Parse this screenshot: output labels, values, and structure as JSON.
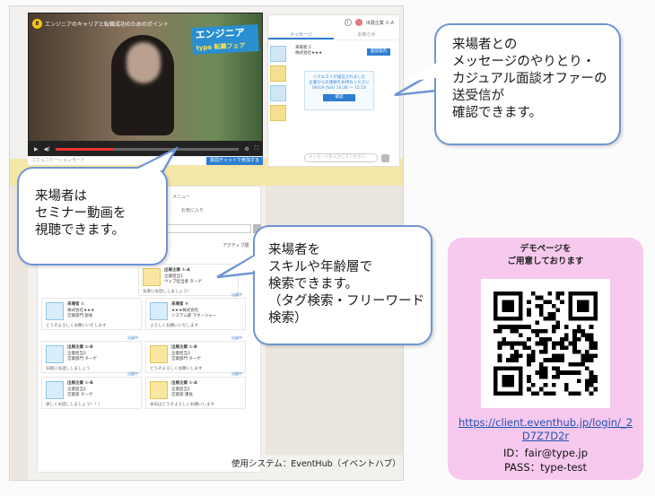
{
  "video": {
    "badge": "8",
    "title": "エンジニアのキャリアと転職成功のためのポイント",
    "logo_main": "エンジニア",
    "logo_sub": "type 転職フェア",
    "caption": "コミュニケーションモード",
    "caption_button": "質問チャットで参加する",
    "progress": 0.32
  },
  "message_panel": {
    "user_name": "出展企業 ①-A",
    "tabs": [
      "メッセージ",
      "お知らせ"
    ],
    "active_tab": "メッセージ",
    "head_line1": "来場者 2",
    "head_line2": "株式会社★★★",
    "head_button": "面談案内",
    "bubble_line1": "リクエストが送信されました",
    "bubble_line2": "企業からの連絡をお待ちください",
    "bubble_time": "06/19 (Sat) 14:30 〜 15:10",
    "bubble_button": "確認",
    "input_placeholder": "メッセージを入力してください"
  },
  "search_area": {
    "menu_text": "メニュー",
    "menu_text2": "お気に入り",
    "sort_label": "アクティブ順",
    "cards": [
      {
        "t1": "出展企業 ①-A",
        "t2": "企業担当1",
        "t3": "ウェブ担当者 ターゲ",
        "msg": "気楽にお話ししましょう！",
        "tag": "",
        "style": "y"
      },
      {
        "t1": "来場者 ①",
        "t2": "株式会社★★★",
        "t3": "営業部門 部長",
        "msg": "どうぞよろしくお願いいたします",
        "tag": "",
        "style": "b"
      },
      {
        "t1": "来場者 ②",
        "t2": "★★★株式会社",
        "t3": "システム部 マネージャー",
        "msg": "よろしくお願いいたします",
        "tag": "出展中",
        "style": "b"
      },
      {
        "t1": "出展企業 ①-B",
        "t2": "企業担当2",
        "t3": "営業部門 ターゲ",
        "msg": "気軽にお話ししましょう",
        "tag": "出展中",
        "style": "b"
      },
      {
        "t1": "出展企業 ①-B",
        "t2": "企業担当3",
        "t3": "営業部門 ターゲ",
        "msg": "どうぞよろしくお願いします",
        "tag": "出展中",
        "style": "y"
      },
      {
        "t1": "出展企業 ①-B",
        "t2": "企業担当1",
        "t3": "営業部 ターゲ",
        "msg": "楽しくお話ししましょう！！！",
        "tag": "出展中",
        "style": "b"
      },
      {
        "t1": "出展企業 ①-A",
        "t2": "企業担当1",
        "t3": "営業部 課長",
        "msg": "本日はどうぞよろしくお願いします",
        "tag": "出展中",
        "style": "y"
      }
    ]
  },
  "system_label": "使用システム：EventHub（イベントハブ）",
  "callouts": {
    "message": [
      "来場者との",
      "メッセージのやりとり・",
      "カジュアル面談オファーの",
      "送受信が",
      "確認できます。"
    ],
    "video": [
      "来場者は",
      "セミナー動画を",
      "視聴できます。"
    ],
    "search": [
      "来場者を",
      "スキルや年齢層で",
      "検索できます。",
      "（タグ検索・フリーワード",
      "検索）"
    ]
  },
  "demo": {
    "heading_line1": "デモページを",
    "heading_line2": "ご用意しております",
    "url_line1": "https://client.eventhub.jp/login/_2",
    "url_line2": "D7Z7D2r",
    "id": "ID：fair@type.jp",
    "pass": "PASS：type-test"
  },
  "colors": {
    "callout_border": "#6f95d3",
    "demo_bg": "#f7c9ee",
    "link": "#2352b0",
    "accent_blue": "#2f7fd0"
  }
}
